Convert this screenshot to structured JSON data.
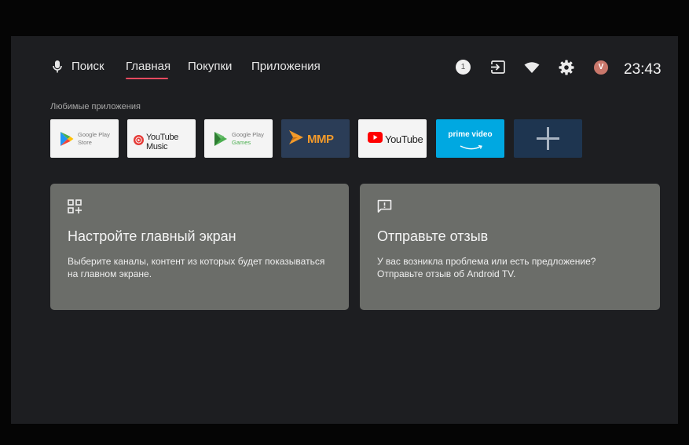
{
  "nav": {
    "search_label": "Поиск",
    "tabs": [
      {
        "label": "Главная",
        "selected": true
      },
      {
        "label": "Покупки"
      },
      {
        "label": "Приложения"
      }
    ]
  },
  "status": {
    "notification_count": "1",
    "avatar_letter": "V",
    "time": "23:43",
    "icons": [
      "notification-badge",
      "input-source-icon",
      "wifi-icon",
      "settings-gear-icon",
      "avatar"
    ]
  },
  "favorites": {
    "title": "Любимые приложения",
    "apps": [
      {
        "name": "Google Play Store",
        "line1": "Google Play",
        "line2": "Store"
      },
      {
        "name": "YouTube Music",
        "label": "YouTube Music"
      },
      {
        "name": "Google Play Games",
        "line1": "Google Play",
        "line2": "Games"
      },
      {
        "name": "MMP",
        "label": "MMP"
      },
      {
        "name": "YouTube",
        "label": "YouTube"
      },
      {
        "name": "Prime Video",
        "label": "prime video"
      },
      {
        "name": "Add app",
        "icon": "plus-icon"
      }
    ]
  },
  "cards": [
    {
      "icon": "dashboard-add-icon",
      "title": "Настройте главный экран",
      "body": "Выберите каналы, контент из которых будет показываться на главном экране."
    },
    {
      "icon": "feedback-icon",
      "title": "Отправьте отзыв",
      "body_line1": "У вас возникла проблема или есть предложение?",
      "body_line2": "Отправьте отзыв об Android TV."
    }
  ],
  "colors": {
    "tab_underline": "#e84a5f",
    "prime_bg": "#00a8e1",
    "mmp_bg": "#2b3d57",
    "add_tile_bg": "#1e3550",
    "card_bg": "#6b6d69"
  }
}
